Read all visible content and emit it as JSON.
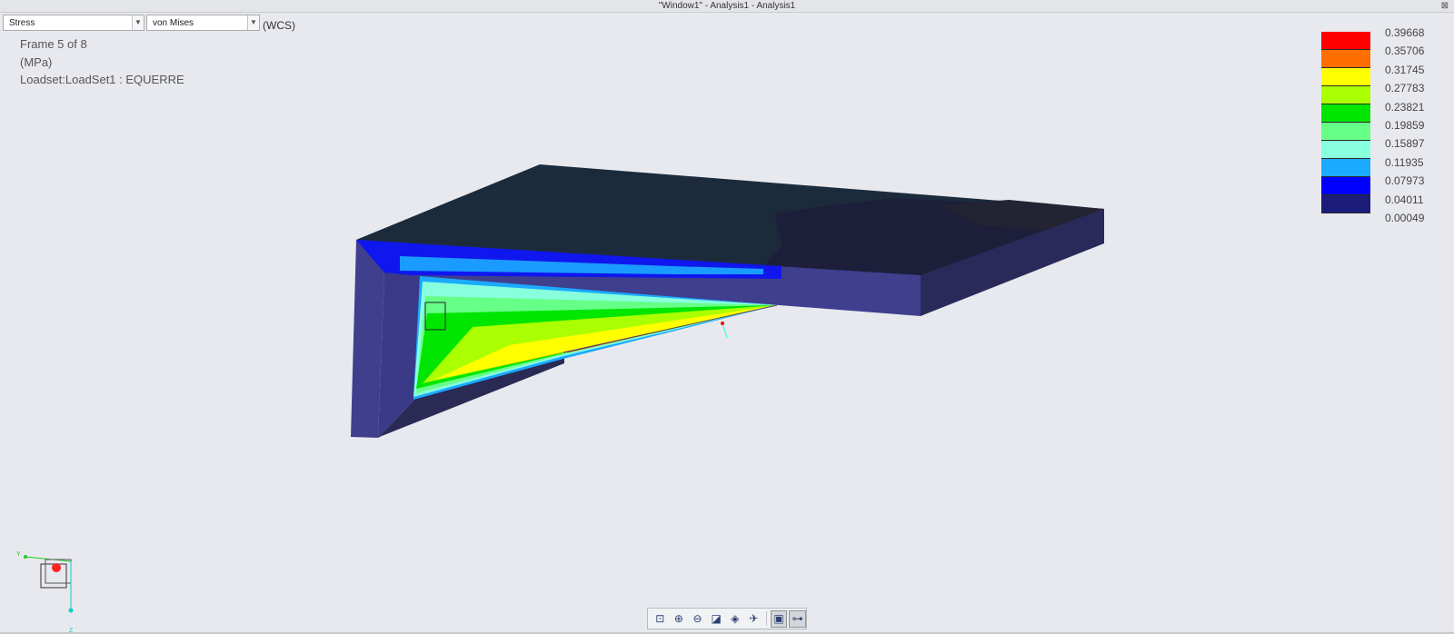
{
  "window": {
    "title": "\"Window1\" - Analysis1 - Analysis1",
    "close_glyph": "⊠"
  },
  "controls": {
    "quantity_select": {
      "value": "Stress"
    },
    "component_select": {
      "value": "von Mises"
    },
    "coordinate_system": "(WCS)"
  },
  "info": {
    "frame": "Frame 5 of 8",
    "units": "(MPa)",
    "loadset": "Loadset:LoadSet1 :  EQUERRE"
  },
  "legend": {
    "labels": [
      "0.39668",
      "0.35706",
      "0.31745",
      "0.27783",
      "0.23821",
      "0.19859",
      "0.15897",
      "0.11935",
      "0.07973",
      "0.04011",
      "0.00049"
    ],
    "colors": [
      "#ff0000",
      "#ff6e00",
      "#ffff00",
      "#aaff00",
      "#00e600",
      "#66ff88",
      "#88ffdd",
      "#1aaaff",
      "#0000ff",
      "#1c1c7a"
    ]
  },
  "triad": {
    "y_axis": "Y",
    "z_axis": "Z"
  },
  "toolbar": {
    "buttons": [
      {
        "name": "refit-icon",
        "glyph": "⊡"
      },
      {
        "name": "zoom-in-icon",
        "glyph": "⊕"
      },
      {
        "name": "zoom-out-icon",
        "glyph": "⊖"
      },
      {
        "name": "repaint-icon",
        "glyph": "◪"
      },
      {
        "name": "saved-views-icon",
        "glyph": "◈"
      },
      {
        "name": "spin-center-icon",
        "glyph": "✈"
      },
      {
        "name": "model-display-icon",
        "glyph": "▣"
      },
      {
        "name": "datum-display-icon",
        "glyph": "⊶"
      }
    ]
  }
}
